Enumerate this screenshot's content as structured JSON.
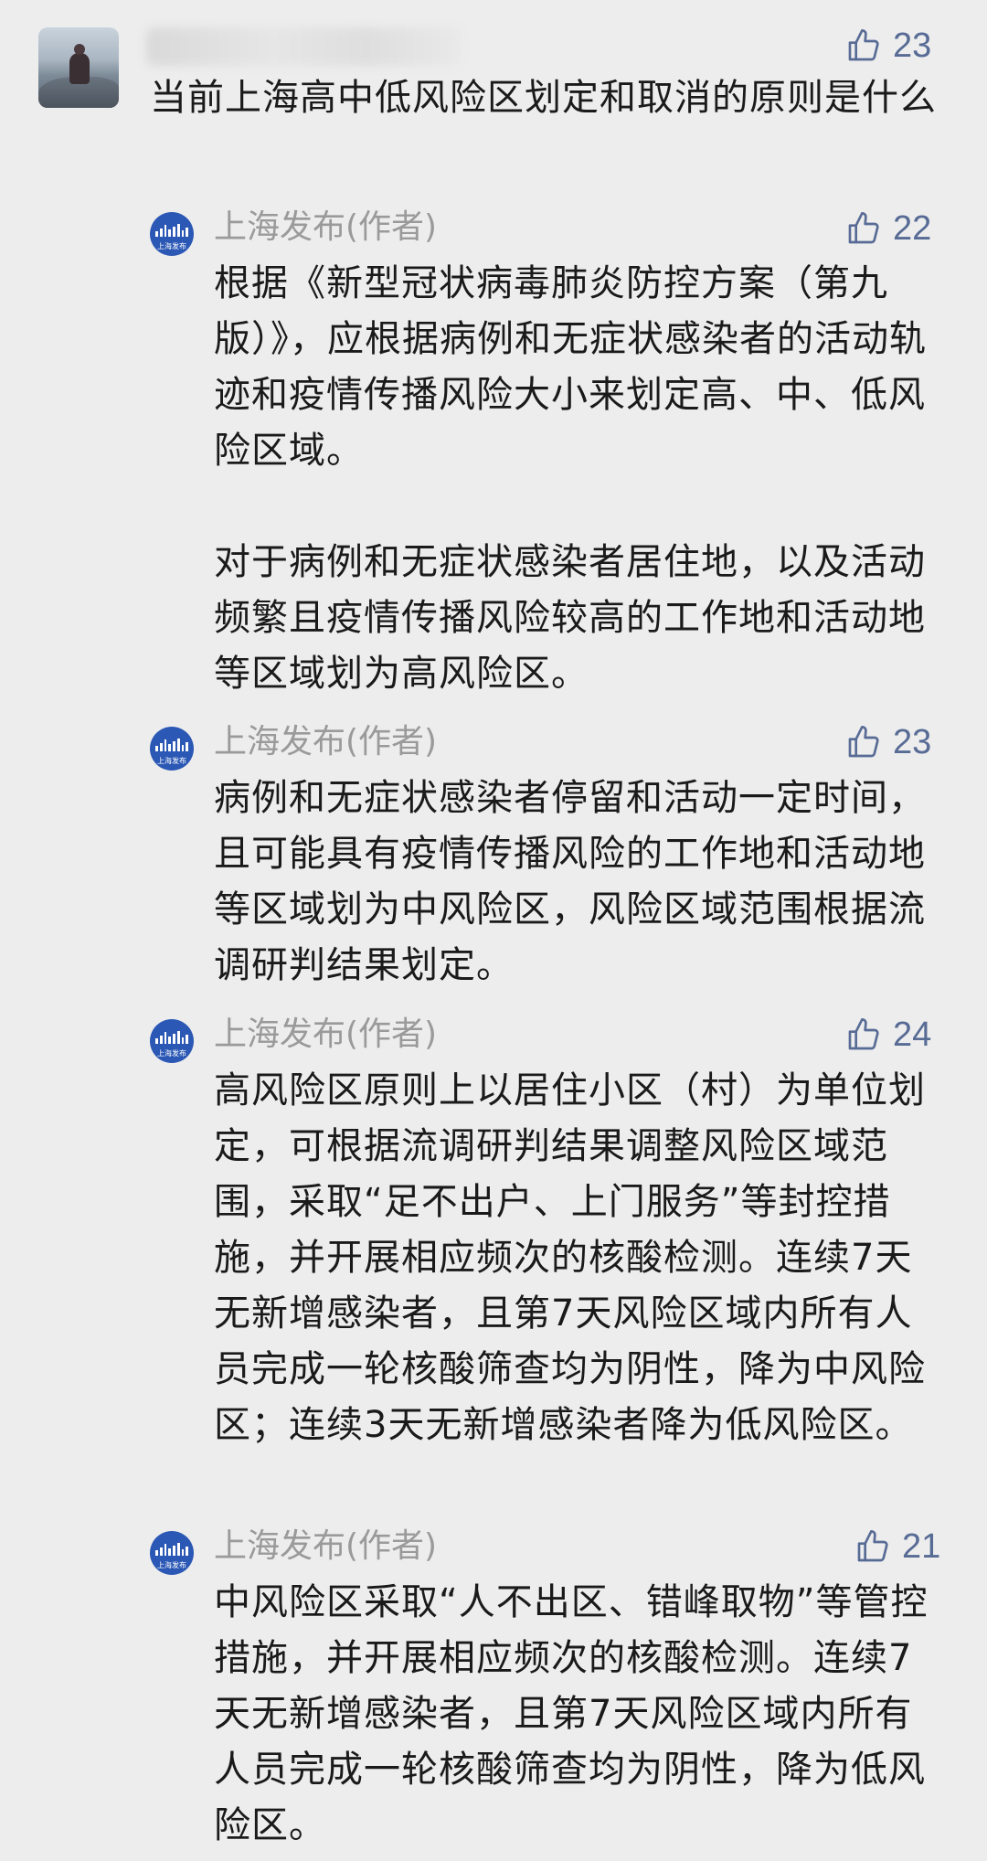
{
  "top_comment": {
    "text": "当前上海高中低风险区划定和取消的原则是什么",
    "likes": "23",
    "like_icon": "thumbs-up-icon"
  },
  "replies": [
    {
      "author": "上海发布(作者)",
      "likes": "22",
      "text": "根据《新型冠状病毒肺炎防控方案（第九版）》，应根据病例和无症状感染者的活动轨迹和疫情传播风险大小来划定高、中、低风险区域。\n\n对于病例和无症状感染者居住地，以及活动频繁且疫情传播风险较高的工作地和活动地等区域划为高风险区。"
    },
    {
      "author": "上海发布(作者)",
      "likes": "23",
      "text": "病例和无症状感染者停留和活动一定时间，且可能具有疫情传播风险的工作地和活动地等区域划为中风险区，风险区域范围根据流调研判结果划定。"
    },
    {
      "author": "上海发布(作者)",
      "likes": "24",
      "text": "高风险区原则上以居住小区（村）为单位划定，可根据流调研判结果调整风险区域范围，采取“足不出户、上门服务”等封控措施，并开展相应频次的核酸检测。连续7天无新增感染者，且第7天风险区域内所有人员完成一轮核酸筛查均为阴性，降为中风险区；连续3天无新增感染者降为低风险区。"
    },
    {
      "author": "上海发布(作者)",
      "likes": "21",
      "text": "中风险区采取“人不出区、错峰取物”等管控措施，并开展相应频次的核酸检测。连续7天无新增感染者，且第7天风险区域内所有人员完成一轮核酸筛查均为阴性，降为低风险区。"
    }
  ],
  "avatar_label": "上海发布",
  "colors": {
    "background": "#ededed",
    "like": "#576b95",
    "author": "#9a9a9a",
    "text": "#1a1a1a",
    "avatar": "#2b58b5"
  }
}
